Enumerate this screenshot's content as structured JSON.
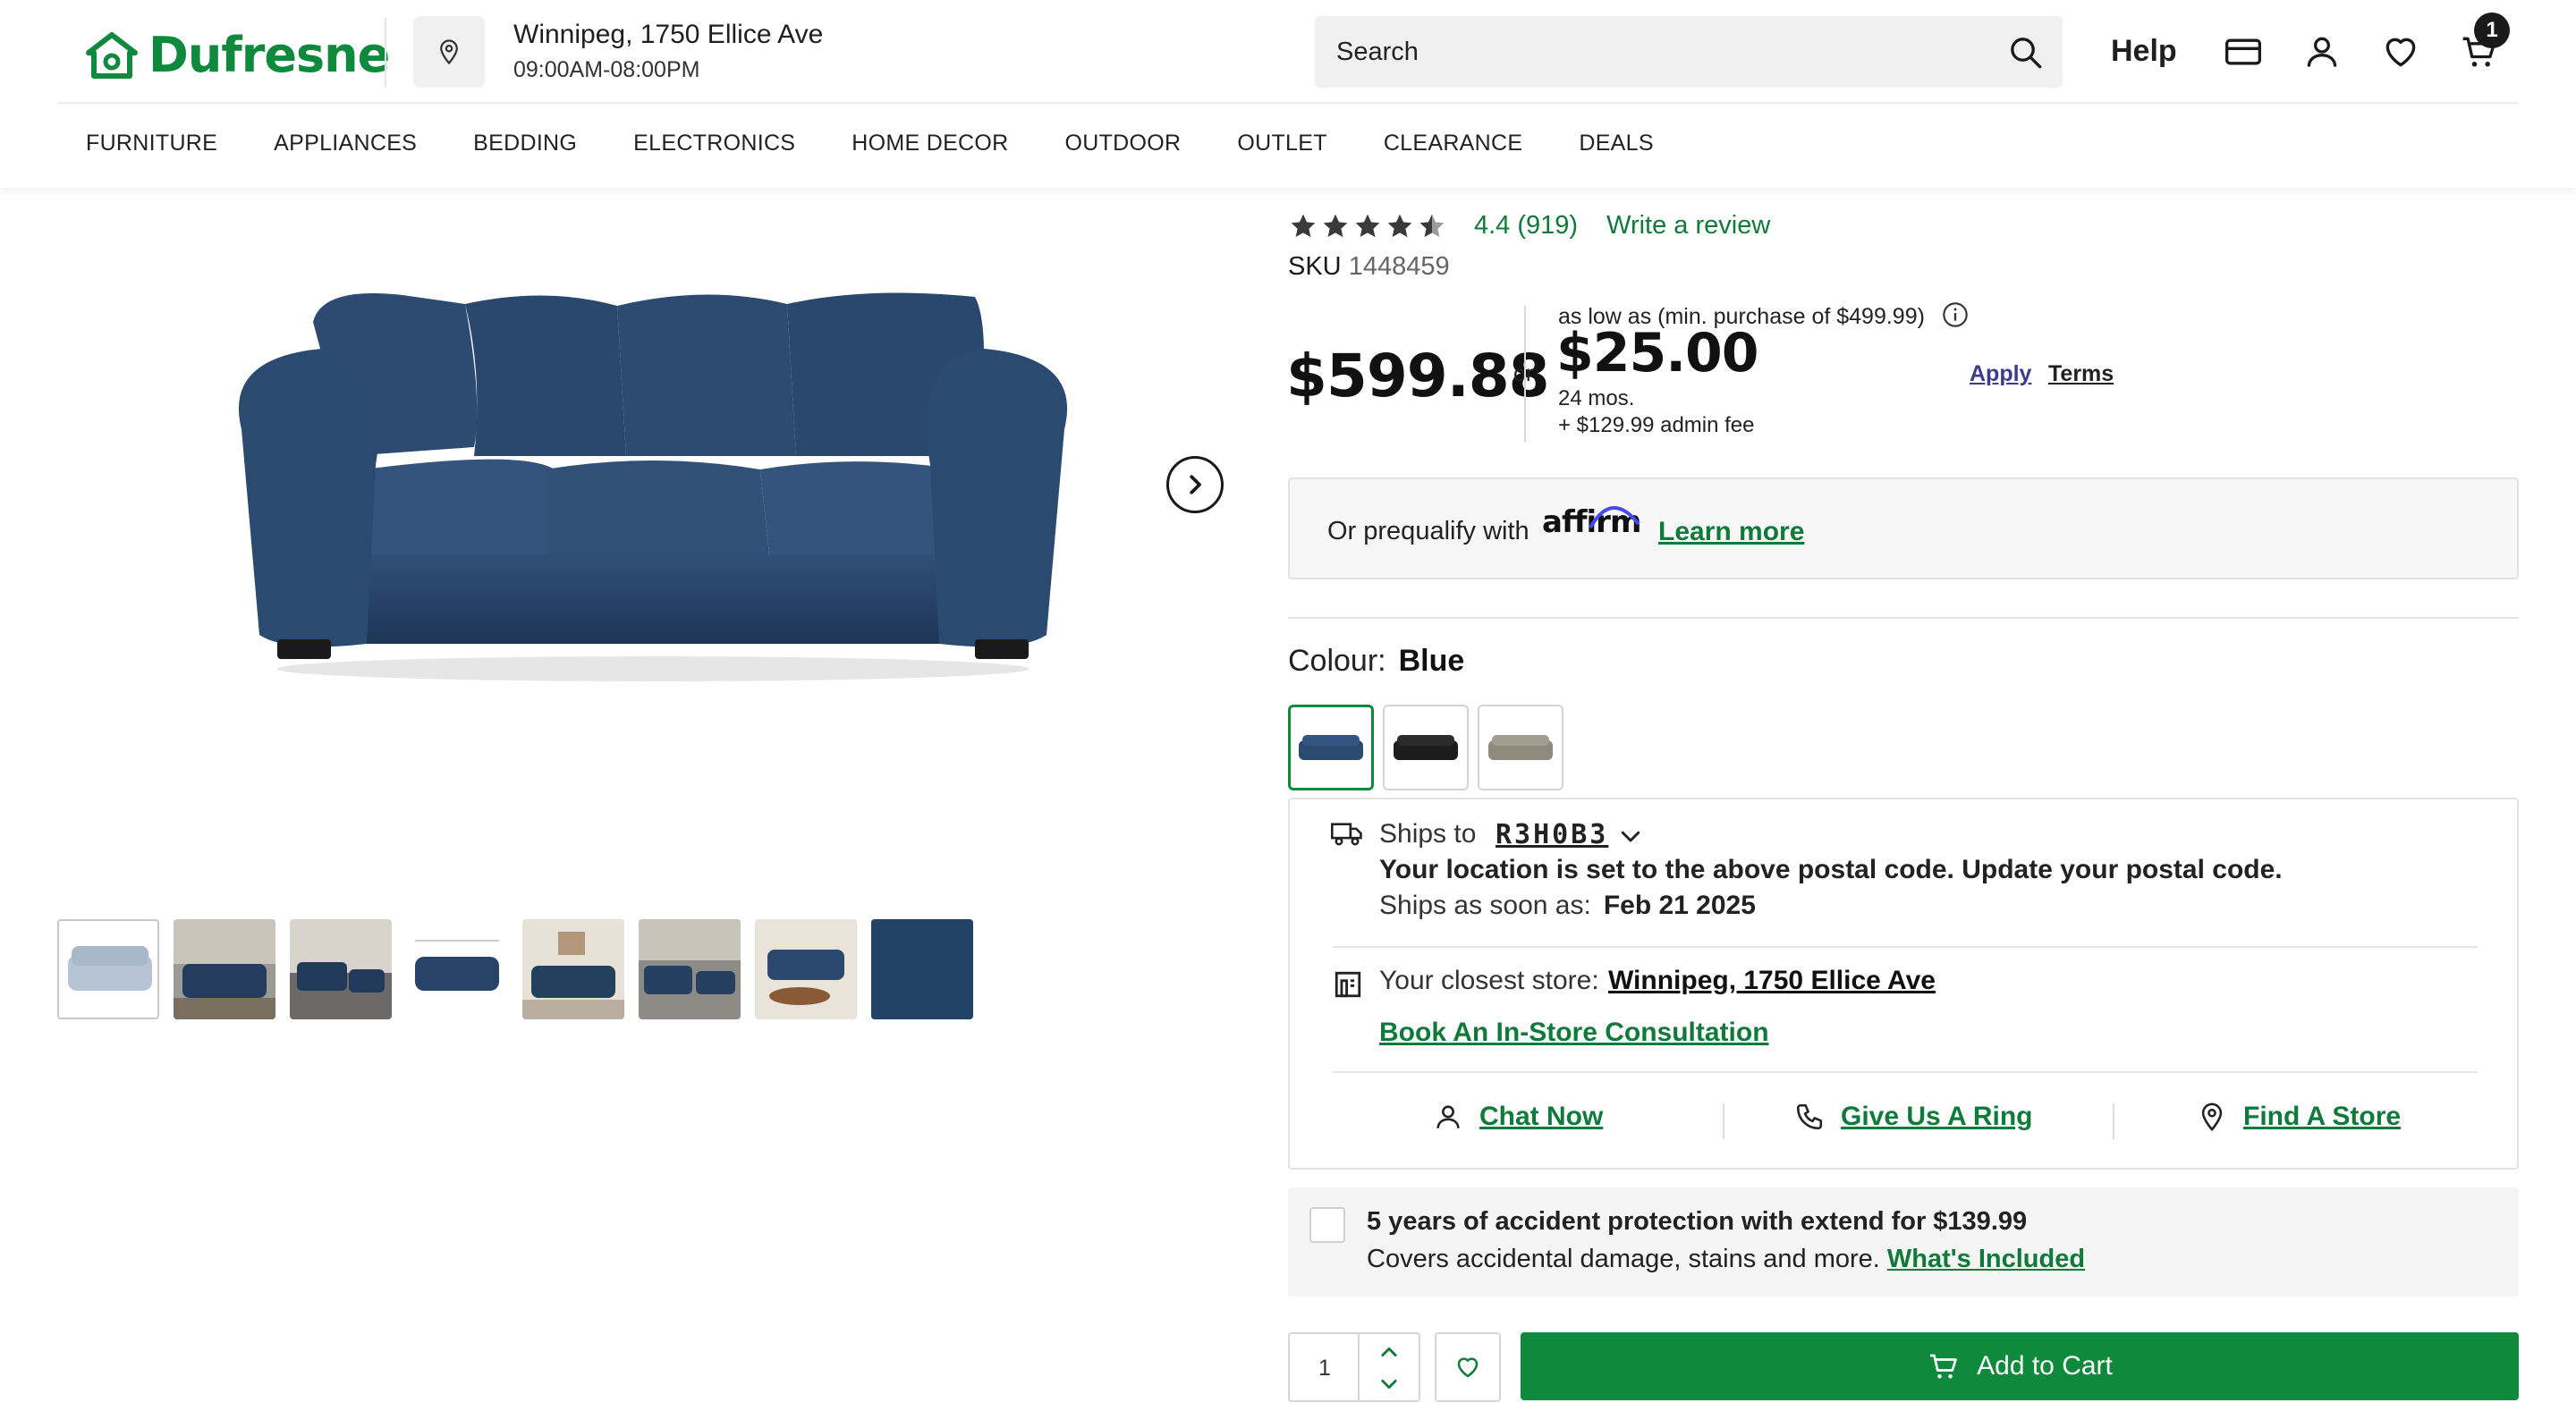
{
  "brand": {
    "name": "Dufresne",
    "color": "#0f8a3c"
  },
  "store": {
    "name": "Winnipeg, 1750 Ellice Ave",
    "hours": "09:00AM-08:00PM"
  },
  "search": {
    "placeholder": "Search"
  },
  "header": {
    "help_label": "Help",
    "cart_count": "1"
  },
  "nav": [
    "FURNITURE",
    "APPLIANCES",
    "BEDDING",
    "ELECTRONICS",
    "HOME DECOR",
    "OUTDOOR",
    "OUTLET",
    "CLEARANCE",
    "DEALS"
  ],
  "product": {
    "rating_stars": 4.4,
    "rating_value": "4.4",
    "review_count": "(919)",
    "write_review": "Write a review",
    "sku_label": "SKU",
    "sku": "1448459",
    "price": "$599.88",
    "or": "or",
    "financing": {
      "label": "as low as (min. purchase of $499.99)",
      "amount": "$25.00",
      "term": "24 mos.",
      "fee": "+ $129.99 admin fee",
      "apply": "Apply",
      "terms": "Terms"
    },
    "affirm": {
      "text": "Or prequalify with",
      "logo": "affirm",
      "learn_more": "Learn more"
    },
    "colour": {
      "label": "Colour:",
      "selected": "Blue",
      "options": [
        "Blue",
        "Black",
        "Grey"
      ]
    },
    "gallery": {
      "thumbnail_count": 8,
      "selected_index": 0
    }
  },
  "shipping": {
    "ships_to": "Ships to",
    "postal_code": "R3H0B3",
    "message": "Your location is set to the above postal code. Update your postal code.",
    "soon_label": "Ships as soon as:",
    "soon_date": "Feb 21 2025",
    "closest_label": "Your closest store:",
    "closest_store": "Winnipeg, 1750 Ellice Ave",
    "consultation": "Book An In-Store Consultation",
    "chat": "Chat Now",
    "ring": "Give Us A Ring",
    "find": "Find A Store"
  },
  "protection": {
    "title": "5 years of accident protection with extend for $139.99",
    "subtitle": "Covers accidental damage, stains and more.",
    "link": "What's Included"
  },
  "purchase": {
    "quantity": "1",
    "add_to_cart": "Add to Cart"
  },
  "icons": {
    "logo": "house-logo-icon",
    "pin": "location-pin-icon",
    "search": "search-icon",
    "payment": "credit-card-icon",
    "account": "user-icon",
    "wishlist": "heart-icon",
    "cart": "cart-icon",
    "info": "info-icon",
    "truck": "truck-icon",
    "store": "store-icon",
    "chat": "person-icon",
    "phone": "phone-icon",
    "map": "map-pin-icon"
  }
}
